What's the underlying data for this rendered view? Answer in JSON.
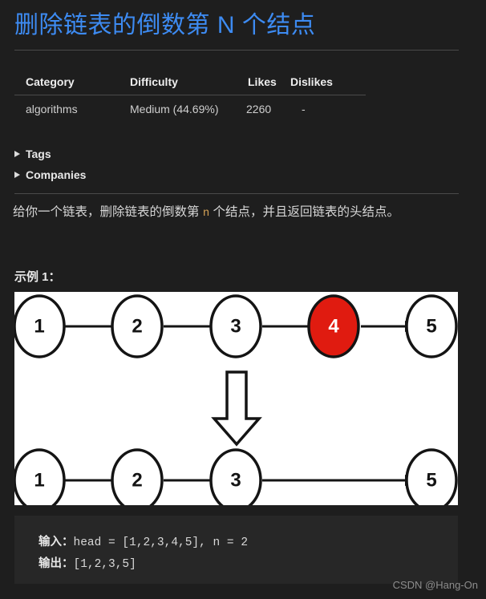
{
  "page": {
    "title": "删除链表的倒数第 N 个结点",
    "background_color": "#1e1e1e",
    "title_color": "#3d8bf2"
  },
  "meta_table": {
    "headers": [
      "Category",
      "Difficulty",
      "Likes",
      "Dislikes"
    ],
    "rows": [
      {
        "category": "algorithms",
        "difficulty": "Medium (44.69%)",
        "likes": "2260",
        "dislikes": "-"
      }
    ]
  },
  "collapsibles": [
    {
      "label": "Tags",
      "expanded": false
    },
    {
      "label": "Companies",
      "expanded": false
    }
  ],
  "description": {
    "before_code": "给你一个链表，删除链表的倒数第 ",
    "code": "n",
    "after_code": " 个结点，并且返回链表的头结点。",
    "code_color": "#d4a256"
  },
  "example": {
    "heading": "示例 1：",
    "figure": {
      "background": "#ffffff",
      "highlight_color": "#e01b10",
      "top_row_nodes": [
        "1",
        "2",
        "3",
        "4",
        "5"
      ],
      "highlighted_node": "4",
      "bottom_row_nodes": [
        "1",
        "2",
        "3",
        "5"
      ],
      "transition_arrow": "down-block-arrow"
    },
    "code_block": {
      "lines": [
        {
          "label": "输入：",
          "value": "head = [1,2,3,4,5], n = 2"
        },
        {
          "label": "输出：",
          "value": "[1,2,3,5]"
        }
      ]
    }
  },
  "watermark": {
    "text": "CSDN @Hang-On"
  }
}
